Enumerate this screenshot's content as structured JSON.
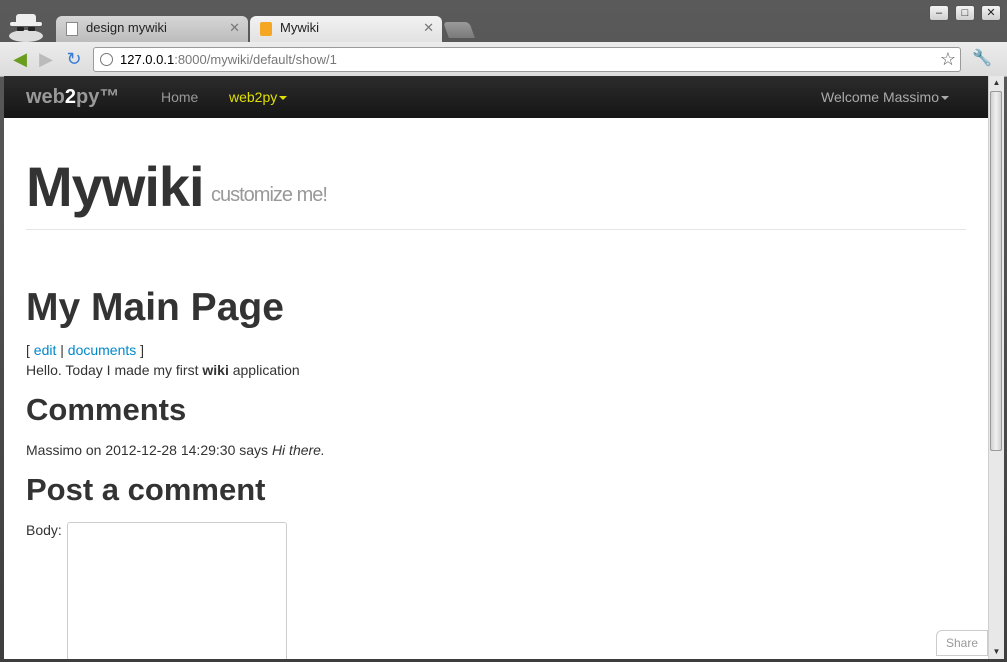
{
  "browser": {
    "tabs": [
      {
        "title": "design mywiki",
        "active": false
      },
      {
        "title": "Mywiki",
        "active": true
      }
    ],
    "window_buttons": {
      "minimize": "–",
      "maximize": "□",
      "close": "✕"
    },
    "url_host": "127.0.0.1",
    "url_rest": ":8000/mywiki/default/show/1"
  },
  "navbar": {
    "brand_prefix": "web",
    "brand_bold": "2",
    "brand_suffix": "py™",
    "home": "Home",
    "web2py_menu": "web2py",
    "welcome": "Welcome Massimo"
  },
  "header": {
    "title": "Mywiki",
    "subtitle": "customize me!"
  },
  "page": {
    "title": "My Main Page",
    "link_open": "[ ",
    "edit_link": "edit",
    "separator": " | ",
    "documents_link": "documents",
    "link_close": " ]",
    "body_prefix": "Hello. Today I made my first ",
    "body_bold": "wiki",
    "body_suffix": " application"
  },
  "comments": {
    "heading": "Comments",
    "items": [
      {
        "author_time": "Massimo on 2012-12-28 14:29:30 says ",
        "text": "Hi there."
      }
    ]
  },
  "post_form": {
    "heading": "Post a comment",
    "body_label": "Body:",
    "body_value": ""
  },
  "share_label": "Share",
  "colors": {
    "link": "#0088cc",
    "navbar_active": "#e0e000",
    "heading": "#333333"
  }
}
